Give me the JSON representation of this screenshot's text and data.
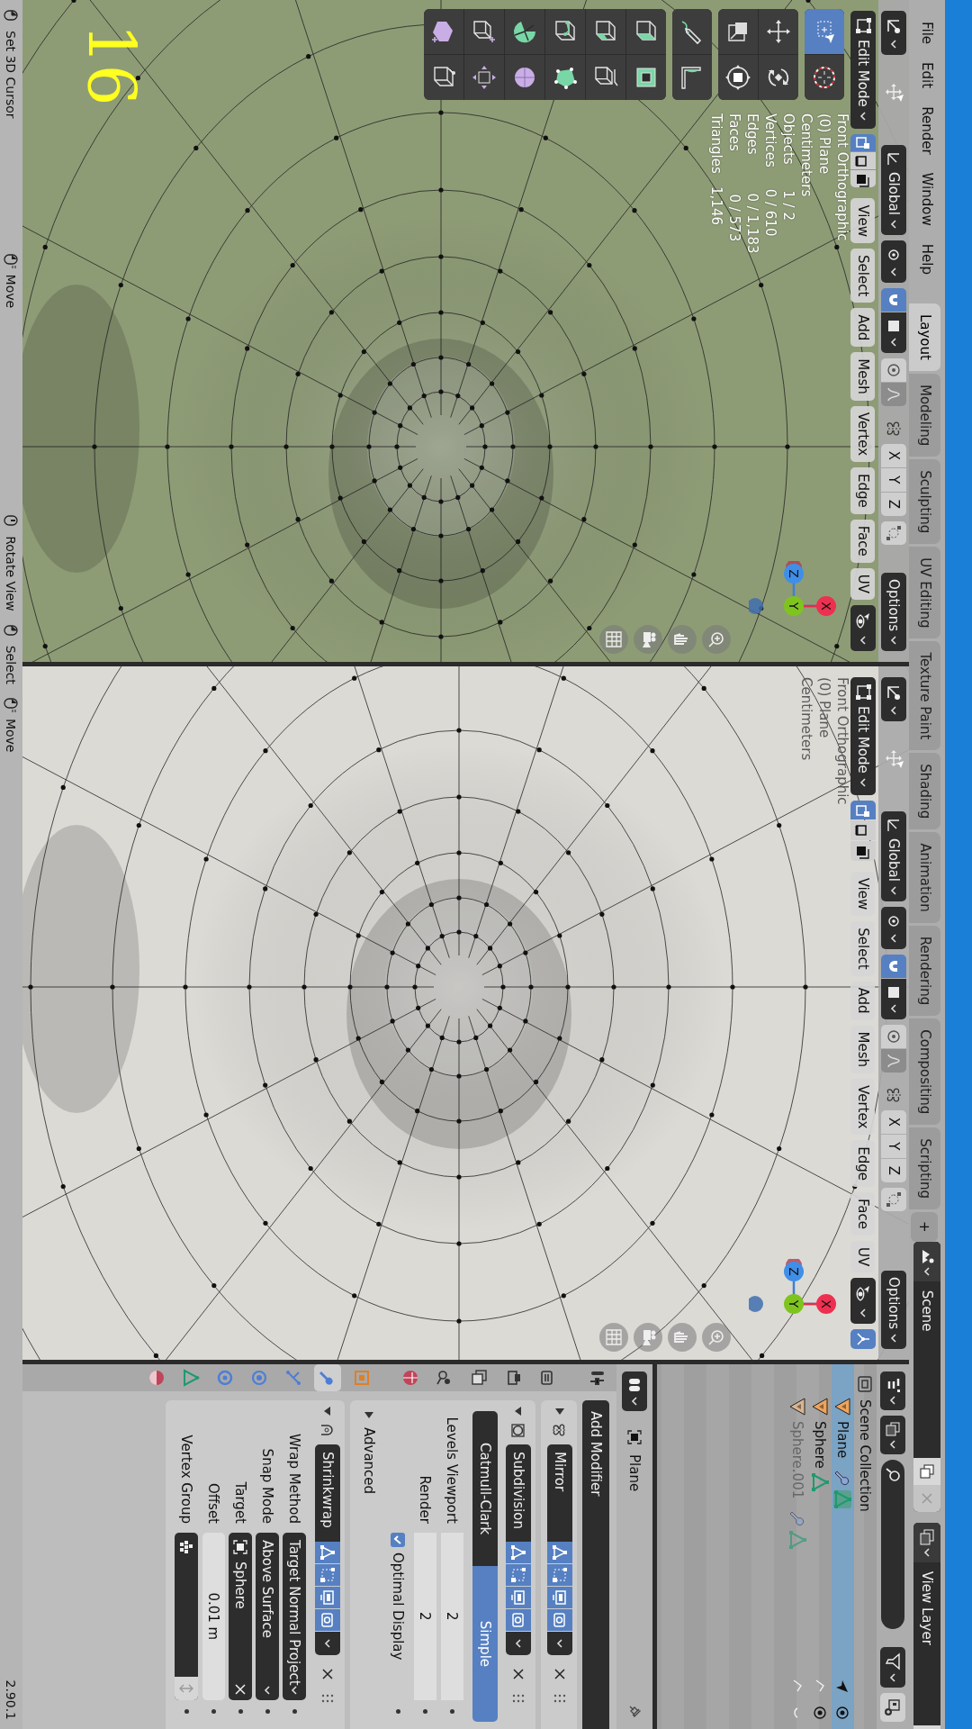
{
  "menu_bar": {
    "menus": [
      "File",
      "Edit",
      "Render",
      "Window",
      "Help"
    ],
    "workspaces": [
      {
        "label": "Layout",
        "selected": true
      },
      {
        "label": "Modeling",
        "selected": false
      },
      {
        "label": "Sculpting",
        "selected": false
      },
      {
        "label": "UV Editing",
        "selected": false
      },
      {
        "label": "Texture Paint",
        "selected": false
      },
      {
        "label": "Shading",
        "selected": false
      },
      {
        "label": "Animation",
        "selected": false
      },
      {
        "label": "Rendering",
        "selected": false
      },
      {
        "label": "Compositing",
        "selected": false
      },
      {
        "label": "Scripting",
        "selected": false
      }
    ],
    "add_workspace": "+",
    "scene": "Scene",
    "view_layer": "View Layer"
  },
  "viewports": [
    {
      "color": "#8e9c76",
      "toolbar_visible": true,
      "tools": [
        {
          "kind": "select-box",
          "selected": true
        },
        {
          "kind": "cursor",
          "selected": false
        },
        {
          "kind": "move",
          "selected": false
        },
        {
          "kind": "rotate",
          "selected": false
        },
        {
          "kind": "scale",
          "selected": false
        },
        {
          "kind": "transform",
          "selected": false
        },
        {
          "kind": "annotate",
          "selected": false
        },
        {
          "kind": "measure",
          "selected": false
        },
        {
          "kind": "extrude",
          "selected": false
        },
        {
          "kind": "inset",
          "selected": false
        },
        {
          "kind": "bevel",
          "selected": false
        },
        {
          "kind": "loop-cut",
          "selected": false
        },
        {
          "kind": "knife",
          "selected": false
        },
        {
          "kind": "poly-build",
          "selected": false
        },
        {
          "kind": "spin",
          "selected": false
        },
        {
          "kind": "smooth",
          "selected": false
        },
        {
          "kind": "extrude-manifold",
          "selected": false
        },
        {
          "kind": "shrink-fatten",
          "selected": false
        },
        {
          "kind": "add-cube",
          "selected": false
        },
        {
          "kind": "rip",
          "selected": false
        }
      ],
      "tool_settings": {
        "orientation": "Global",
        "snap": true,
        "proportional": false,
        "axes": [
          {
            "label": "X",
            "selected": false
          },
          {
            "label": "Y",
            "selected": false
          },
          {
            "label": "Z",
            "selected": false
          }
        ],
        "options": "Options"
      },
      "header": {
        "mode": "Edit Mode",
        "select_modes": [
          {
            "selected": true
          },
          {
            "selected": false
          },
          {
            "selected": false
          }
        ],
        "menus": [
          "View",
          "Select",
          "Add",
          "Mesh",
          "Vertex",
          "Edge",
          "Face",
          "UV"
        ],
        "gizmo_toggle": false
      },
      "overlay_text": [
        "Front Orthographic",
        "(0) Plane",
        "Centimeters"
      ],
      "statistics": [
        "Objects      1 / 2",
        "Vertices     0 / 610",
        "Edges         0 / 1,183",
        "Faces          0 / 573",
        "Triangles   1,146"
      ],
      "gizmo_labels": [
        "Z",
        "Y",
        "X"
      ]
    },
    {
      "color": "#dcdad5",
      "toolbar_visible": false,
      "tool_settings": {
        "orientation": "Global",
        "snap": true,
        "proportional": false,
        "axes": [
          {
            "label": "X",
            "selected": false
          },
          {
            "label": "Y",
            "selected": false
          },
          {
            "label": "Z",
            "selected": false
          }
        ],
        "options": "Options"
      },
      "header": {
        "mode": "Edit Mode",
        "select_modes": [
          {
            "selected": true
          },
          {
            "selected": false
          },
          {
            "selected": false
          }
        ],
        "menus": [
          "View",
          "Select",
          "Add",
          "Mesh",
          "Vertex",
          "Edge",
          "Face",
          "UV"
        ],
        "gizmo_toggle": true
      },
      "overlay_text": [
        "Front Orthographic",
        "(0) Plane",
        "Centimeters"
      ],
      "gizmo_labels": [
        "Z",
        "Y",
        "X"
      ]
    }
  ],
  "step_number": "16",
  "outliner": {
    "items": [
      {
        "name": "Scene Collection",
        "kind": "collection",
        "children": [
          {
            "name": "Plane",
            "kind": "object",
            "selected": true,
            "has_modifiers": true,
            "visible": true
          },
          {
            "name": "Sphere",
            "kind": "object",
            "selected": false,
            "has_modifiers": false,
            "visible": true
          },
          {
            "name": "Sphere.001",
            "kind": "object",
            "selected": false,
            "has_modifiers": true,
            "visible": false
          }
        ]
      }
    ]
  },
  "properties": {
    "tabs": [
      {
        "kind": "tool",
        "selected": false
      },
      {
        "kind": "render",
        "selected": false
      },
      {
        "kind": "output",
        "selected": false
      },
      {
        "kind": "view-layer",
        "selected": false
      },
      {
        "kind": "scene",
        "selected": false
      },
      {
        "kind": "world",
        "selected": false
      },
      {
        "kind": "object",
        "selected": false
      },
      {
        "kind": "modifiers",
        "selected": true
      },
      {
        "kind": "particles",
        "selected": false
      },
      {
        "kind": "physics",
        "selected": false
      },
      {
        "kind": "constraints",
        "selected": false
      },
      {
        "kind": "data",
        "selected": false
      },
      {
        "kind": "material",
        "selected": false
      }
    ],
    "object_name": "Plane",
    "add_modifier": "Add Modifier",
    "modifiers": [
      {
        "kind": "mirror",
        "name": "Mirror",
        "expanded": false,
        "toggles": [
          {
            "on": true
          },
          {
            "on": true
          },
          {
            "on": true
          },
          {
            "on": true
          }
        ]
      },
      {
        "kind": "subdivision",
        "name": "Subdivision",
        "expanded": true,
        "toggles": [
          {
            "on": true
          },
          {
            "on": true
          },
          {
            "on": true
          },
          {
            "on": true
          }
        ],
        "algorithms": [
          {
            "label": "Catmull-Clark",
            "selected": false
          },
          {
            "label": "Simple",
            "selected": true
          }
        ],
        "fields": [
          {
            "label": "Levels Viewport",
            "value": "2"
          },
          {
            "label": "Render",
            "value": "2"
          }
        ],
        "optimal_display": {
          "label": "Optimal Display",
          "checked": true
        },
        "advanced": {
          "label": "Advanced",
          "expanded": false
        }
      },
      {
        "kind": "shrinkwrap",
        "name": "Shrinkwrap",
        "expanded": true,
        "toggles": [
          {
            "on": true
          },
          {
            "on": true
          },
          {
            "on": true
          },
          {
            "on": true
          }
        ],
        "fields": [
          {
            "label": "Wrap Method",
            "value": "Target Normal Project",
            "kind": "dropdown"
          },
          {
            "label": "Snap Mode",
            "value": "Above Surface",
            "kind": "dropdown"
          },
          {
            "label": "Target",
            "value": "Sphere",
            "kind": "object"
          },
          {
            "label": "Offset",
            "value": "0.01 m",
            "kind": "number"
          },
          {
            "label": "Vertex Group",
            "kind": "group"
          }
        ]
      }
    ]
  },
  "status_bar": {
    "hints": [
      {
        "label": "Set 3D Cursor",
        "kind": "click"
      },
      {
        "label": "Move",
        "kind": "drag"
      },
      {
        "label": "Rotate View",
        "kind": "middle"
      },
      {
        "label": "Select",
        "kind": "click"
      },
      {
        "label": "Move",
        "kind": "drag"
      }
    ],
    "version": "2.90.1"
  }
}
